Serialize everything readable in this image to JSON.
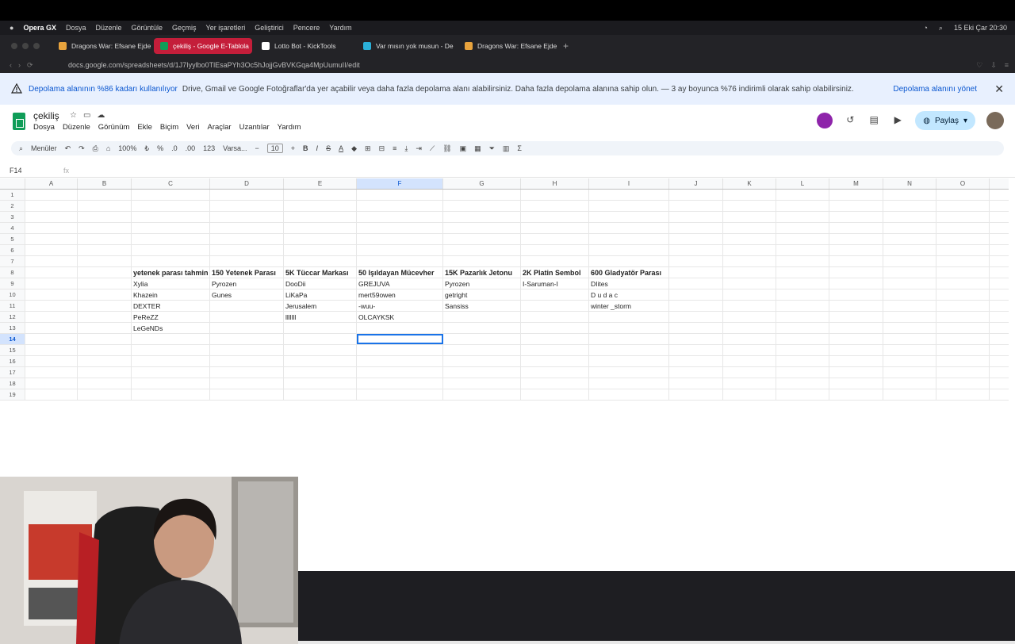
{
  "macos_menu": {
    "app": "Opera GX",
    "items": [
      "Dosya",
      "Düzenle",
      "Görüntüle",
      "Geçmiş",
      "Yer işaretleri",
      "Geliştirici",
      "Pencere",
      "Yardım"
    ],
    "clock": "15 Eki Çar 20:30"
  },
  "tabs": [
    {
      "label": "Dragons War: Efsane Ejde",
      "active": false,
      "icon_color": "#e8a33d"
    },
    {
      "label": "çekiliş - Google E-Tablola",
      "active": true,
      "icon_color": "#0f9d58"
    },
    {
      "label": "Lotto Bot - KickTools",
      "active": false,
      "icon_color": "#ffffff"
    },
    {
      "label": "Var mısın yok musun - De",
      "active": false,
      "icon_color": "#2bb0d8"
    },
    {
      "label": "Dragons War: Efsane Ejde",
      "active": false,
      "icon_color": "#e8a33d"
    }
  ],
  "url": "docs.google.com/spreadsheets/d/1J7Iyylbo0TlEsaPYh3Oc5hJojjGvBVKGqa4MpUumuII/edit",
  "banner": {
    "bold": "Depolama alanının %86 kadarı kullanılıyor",
    "text": "Drive, Gmail ve Google Fotoğraflar'da yer açabilir veya daha fazla depolama alanı alabilirsiniz. Daha fazla depolama alanına sahip olun. — 3 ay boyunca %76 indirimli olarak sahip olabilirsiniz.",
    "manage": "Depolama alanını yönet"
  },
  "doc": {
    "title": "çekiliş",
    "menus": [
      "Dosya",
      "Düzenle",
      "Görünüm",
      "Ekle",
      "Biçim",
      "Veri",
      "Araçlar",
      "Uzantılar",
      "Yardım"
    ],
    "share": "Paylaş"
  },
  "toolbar": {
    "search": "Menüler",
    "zoom": "100%",
    "percent": "%",
    "dec1": ".0",
    "dec2": ".00",
    "num": "123",
    "font": "Varsa...",
    "font_size": "10"
  },
  "formula": {
    "cell_ref": "F14",
    "fx": "fx"
  },
  "columns": [
    "A",
    "B",
    "C",
    "D",
    "E",
    "F",
    "G",
    "H",
    "I",
    "J",
    "K",
    "L",
    "M",
    "N",
    "O"
  ],
  "rows": {
    "r8": [
      "",
      "",
      "yetenek parası tahmin",
      "150 Yetenek Parası",
      "5K Tüccar Markası",
      "50 Işıldayan Mücevher",
      "15K Pazarlık Jetonu",
      "2K Platin Sembol",
      "600 Gladyatör Parası"
    ],
    "r9": [
      "",
      "",
      "Xylia",
      "Pyrozen",
      "DooDii",
      "GREJUVA",
      "Pyrozen",
      "I-Saruman-I",
      "DIites"
    ],
    "r10": [
      "",
      "",
      "Khazein",
      "Gunes",
      "LiKaPa",
      "mert59owen",
      "getright",
      "",
      "D u d a c"
    ],
    "r11": [
      "",
      "",
      "DEXTER",
      "",
      "Jerusalem",
      "-wuu-",
      "Sansiss",
      "",
      "winter _storm"
    ],
    "r12": [
      "",
      "",
      "PeReZZ",
      "",
      "lllllll",
      "OLCAYKSK",
      "",
      "",
      ""
    ],
    "r13": [
      "",
      "",
      "LeGeNDs",
      "",
      "",
      "",
      "",
      "",
      ""
    ]
  },
  "selected_cell": "F14",
  "accent_color": "#1a73e8"
}
